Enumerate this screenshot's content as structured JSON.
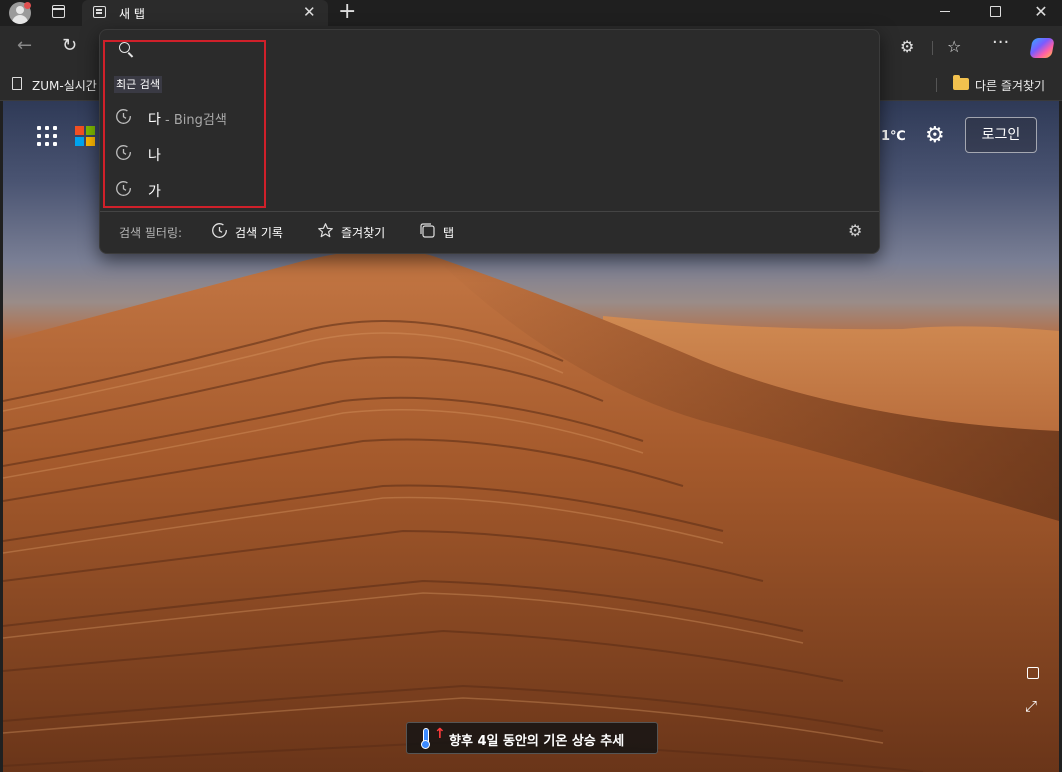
{
  "titlebar": {
    "tab_title": "새 탭",
    "tab_close": "✕",
    "new_tab": "+",
    "minimize": "",
    "maximize": "",
    "close": "✕"
  },
  "toolbar": {
    "back": "←",
    "refresh": "↻",
    "extensions": "⚙",
    "favorites": "☆",
    "more": "···"
  },
  "favorites_bar": {
    "item1": "ZUM-실시간",
    "other_favorites": "다른 즐겨찾기"
  },
  "newtab": {
    "weather_temp": "1℃",
    "settings_icon": "⚙",
    "login": "로그인",
    "banner": "향후 4일 동안의 기온 상승 추세",
    "expand_icon": "⤢"
  },
  "dropdown": {
    "section_label": "최근 검색",
    "history": [
      {
        "text": "다",
        "suffix": " - Bing검색"
      },
      {
        "text": "나",
        "suffix": ""
      },
      {
        "text": "가",
        "suffix": ""
      }
    ],
    "filter_label": "검색 필터링:",
    "filters": {
      "history": "검색 기록",
      "favorites": "즐겨찾기",
      "tabs": "탭"
    },
    "settings_icon": "⚙"
  },
  "colors": {
    "highlight_box": "#d0202a",
    "dropdown_bg": "#2b2b2b",
    "chrome_bg": "#202020"
  }
}
